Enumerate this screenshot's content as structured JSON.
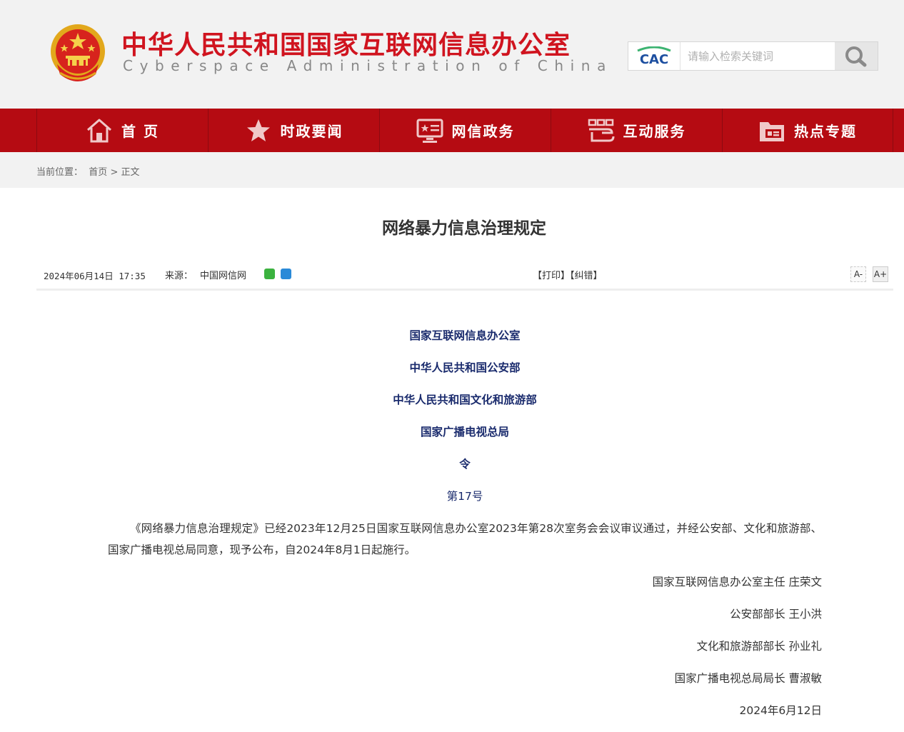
{
  "header": {
    "title": "中华人民共和国国家互联网信息办公室",
    "subtitle": "Cyberspace Administration of China",
    "search_logo": "CAC",
    "search_placeholder": "请输入检索关键词",
    "colors": {
      "brand_red": "#d0141f",
      "nav_red": "#b50b12"
    }
  },
  "nav": {
    "items": [
      {
        "label": "首 页",
        "icon": "home-icon"
      },
      {
        "label": "时政要闻",
        "icon": "star-icon"
      },
      {
        "label": "网信政务",
        "icon": "monitor-icon"
      },
      {
        "label": "互动服务",
        "icon": "handshake-icon"
      },
      {
        "label": "热点专题",
        "icon": "folder-icon"
      }
    ]
  },
  "breadcrumb": {
    "prefix": "当前位置：",
    "home": "首页",
    "separator": ">",
    "current": "正文"
  },
  "article": {
    "title": "网络暴力信息治理规定",
    "date": "2024年06月14日 17:35",
    "source_label": "来源：",
    "source": "中国网信网",
    "print_label": "【打印】",
    "error_label": "【纠错】",
    "font_smaller": "A-",
    "font_larger": "A+",
    "issuers": [
      "国家互联网信息办公室",
      "中华人民共和国公安部",
      "中华人民共和国文化和旅游部",
      "国家广播电视总局"
    ],
    "order_label": "令",
    "order_number": "第17号",
    "body": "《网络暴力信息治理规定》已经2023年12月25日国家互联网信息办公室2023年第28次室务会会议审议通过，并经公安部、文化和旅游部、国家广播电视总局同意，现予公布，自2024年8月1日起施行。",
    "signatories": [
      "国家互联网信息办公室主任 庄荣文",
      "公安部部长 王小洪",
      "文化和旅游部部长 孙业礼",
      "国家广播电视总局局长 曹淑敏"
    ],
    "sign_date": "2024年6月12日"
  }
}
